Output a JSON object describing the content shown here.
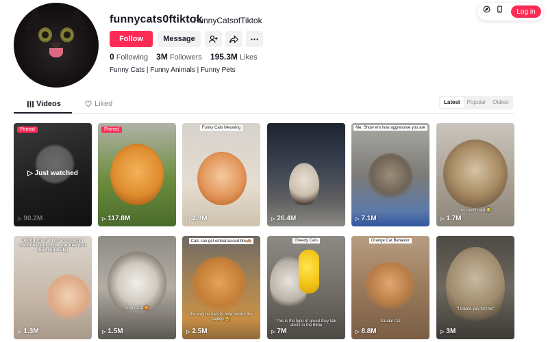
{
  "profile": {
    "username": "funnycats0ftiktok",
    "nickname": "FunnyCatsofTiktok",
    "follow_label": "Follow",
    "message_label": "Message",
    "following_count": "0",
    "following_label": "Following",
    "followers_count": "3M",
    "followers_label": "Followers",
    "likes_count": "195.3M",
    "likes_label": "Likes",
    "bio": "Funny Cats | Funny Animals | Funny Pets"
  },
  "topbar": {
    "login_label": "Log in"
  },
  "tabs": {
    "videos_label": "Videos",
    "liked_label": "Liked"
  },
  "sort": {
    "latest": "Latest",
    "popular": "Popular",
    "oldest": "Oldest"
  },
  "colors": {
    "accent": "#fe2c55"
  },
  "videos": [
    {
      "views": "90.2M",
      "pinned": "Pinned",
      "overlay": "Just watched"
    },
    {
      "views": "117.8M",
      "pinned": "Pinned"
    },
    {
      "views": "2.9M",
      "caption": "Funny Cats Meowing"
    },
    {
      "views": "26.4M"
    },
    {
      "views": "7.1M",
      "caption": "Me: Show em how aggressive you are"
    },
    {
      "views": "1.7M",
      "caption": "bro really said 😂"
    },
    {
      "views": "1.3M",
      "caption": "telling my cat I'm so hungry I could eat our other cat that just died (rip bella)"
    },
    {
      "views": "1.5M",
      "caption": "Angry Cat 😡"
    },
    {
      "views": "2.5M",
      "caption": "Cats can get embarrassed btw🙈",
      "caption2": "the way he tries to hide behind the laptop 😂"
    },
    {
      "views": "7M",
      "caption": "Greedy Cats",
      "caption2": "This is the type of greed they talk about in the Bible"
    },
    {
      "views": "8.8M",
      "caption": "Orange Cat Behavior",
      "caption2": "Sandal Cat"
    },
    {
      "views": "3M",
      "caption": "\"I blame you for this\""
    }
  ]
}
